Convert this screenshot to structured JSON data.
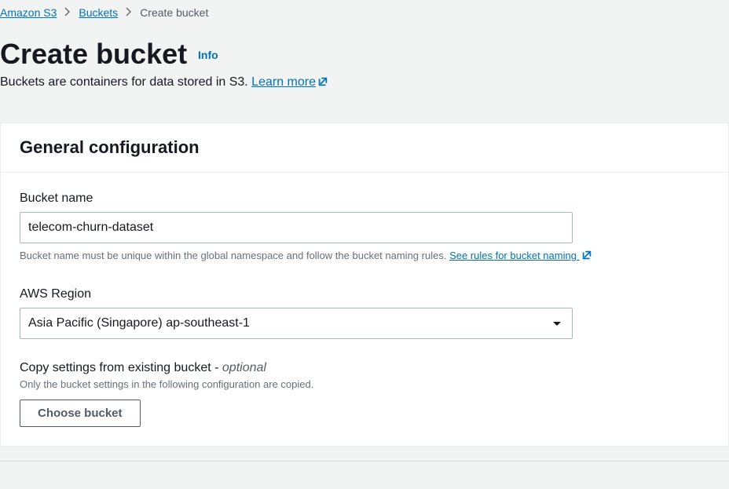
{
  "breadcrumb": {
    "root": "Amazon S3",
    "level1": "Buckets",
    "current": "Create bucket"
  },
  "header": {
    "title": "Create bucket",
    "info_label": "Info",
    "subtitle_prefix": "Buckets are containers for data stored in S3. ",
    "learn_more": "Learn more"
  },
  "panel": {
    "title": "General configuration"
  },
  "bucket_name": {
    "label": "Bucket name",
    "value": "telecom-churn-dataset",
    "hint_prefix": "Bucket name must be unique within the global namespace and follow the bucket naming rules. ",
    "hint_link": "See rules for bucket naming"
  },
  "region": {
    "label": "AWS Region",
    "selected": "Asia Pacific (Singapore) ap-southeast-1"
  },
  "copy_settings": {
    "label_prefix": "Copy settings from existing bucket - ",
    "optional": "optional",
    "hint": "Only the bucket settings in the following configuration are copied.",
    "button": "Choose bucket"
  }
}
